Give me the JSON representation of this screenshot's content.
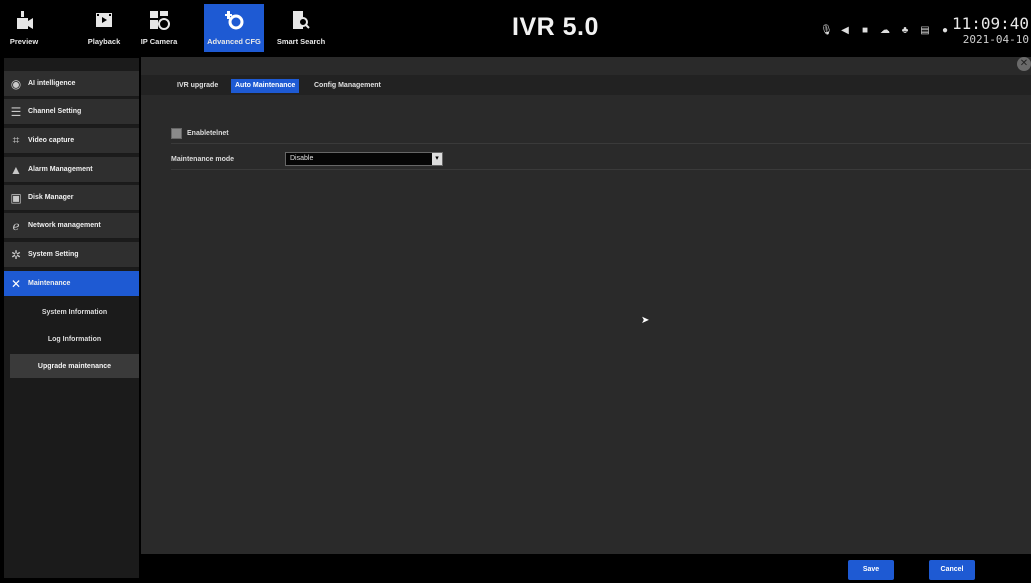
{
  "topnav": [
    {
      "label": "Preview",
      "icon": "preview-icon"
    },
    {
      "label": "Playback",
      "icon": "playback-icon"
    },
    {
      "label": "IP Camera",
      "icon": "ip-camera-icon"
    },
    {
      "label": "Advanced CFG",
      "icon": "advanced-cfg-icon",
      "active": true
    },
    {
      "label": "Smart Search",
      "icon": "smart-search-icon"
    }
  ],
  "brand": "IVR 5.0",
  "status_icons": [
    "microphone-icon",
    "speaker-icon",
    "record-icon",
    "cloud-icon",
    "network-icon",
    "monitor-icon",
    "info-icon"
  ],
  "clock": {
    "time": "11:09:40",
    "date": "2021-04-10"
  },
  "sidebar": {
    "items": [
      {
        "label": "AI intelligence",
        "icon": "ai-head-icon"
      },
      {
        "label": "Channel Setting",
        "icon": "channel-list-icon"
      },
      {
        "label": "Video capture",
        "icon": "crop-icon"
      },
      {
        "label": "Alarm Management",
        "icon": "bell-icon"
      },
      {
        "label": "Disk Manager",
        "icon": "disk-icon"
      },
      {
        "label": "Network management",
        "icon": "browser-icon"
      },
      {
        "label": "System Setting",
        "icon": "gear-icon"
      },
      {
        "label": "Maintenance",
        "icon": "tools-icon",
        "active": true
      }
    ],
    "subitems": [
      {
        "label": "System Information"
      },
      {
        "label": "Log Information"
      },
      {
        "label": "Upgrade maintenance",
        "active": true
      }
    ]
  },
  "tabs": [
    {
      "label": "IVR upgrade"
    },
    {
      "label": "Auto Maintenance",
      "active": true
    },
    {
      "label": "Config Management"
    }
  ],
  "form": {
    "enable_telnet_label": "Enabletelnet",
    "enable_telnet_checked": false,
    "maintenance_mode_label": "Maintenance mode",
    "maintenance_mode_value": "Disable"
  },
  "buttons": {
    "save": "Save",
    "cancel": "Cancel"
  },
  "colors": {
    "accent": "#1e5ad3",
    "background": "#2a2a2a",
    "sidebar": "#2f2f2f"
  }
}
